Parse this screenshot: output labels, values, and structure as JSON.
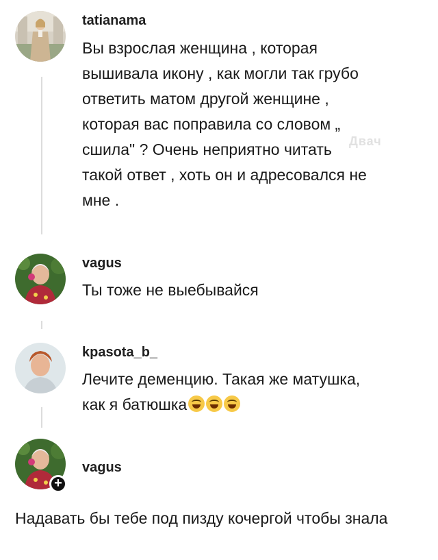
{
  "comments": [
    {
      "username": "tatianama",
      "avatar": "woman-in-beige-suit-photo",
      "text": "Вы взрослая женщина , которая\nвышивала икону , как могли так грубо\nответить матом другой женщине ,\nкоторая вас поправила со словом „\nсшила\" ? Очень неприятно читать\nтакой ответ , хоть он и адресовался не\nмне ."
    },
    {
      "username": "vagus",
      "avatar": "elderly-woman-with-flowers-photo",
      "text": "Ты тоже не выебывайся"
    },
    {
      "username": "kpasota_b_",
      "avatar": "woman-portrait-photo",
      "text": "Лечите деменцию. Такая же матушка,\nкак я батюшка",
      "emojis": [
        "rofl-emoji",
        "rofl-emoji",
        "rofl-emoji"
      ]
    },
    {
      "username": "vagus",
      "avatar": "elderly-woman-with-flowers-photo",
      "badge": "+"
    }
  ],
  "reply_text": "Надавать бы тебе под пизду кочергой чтобы\nзнала",
  "watermark": "Двач",
  "colors": {
    "background": "#ffffff",
    "text": "#1a1a1a",
    "thread_line": "#dcdcdc"
  }
}
